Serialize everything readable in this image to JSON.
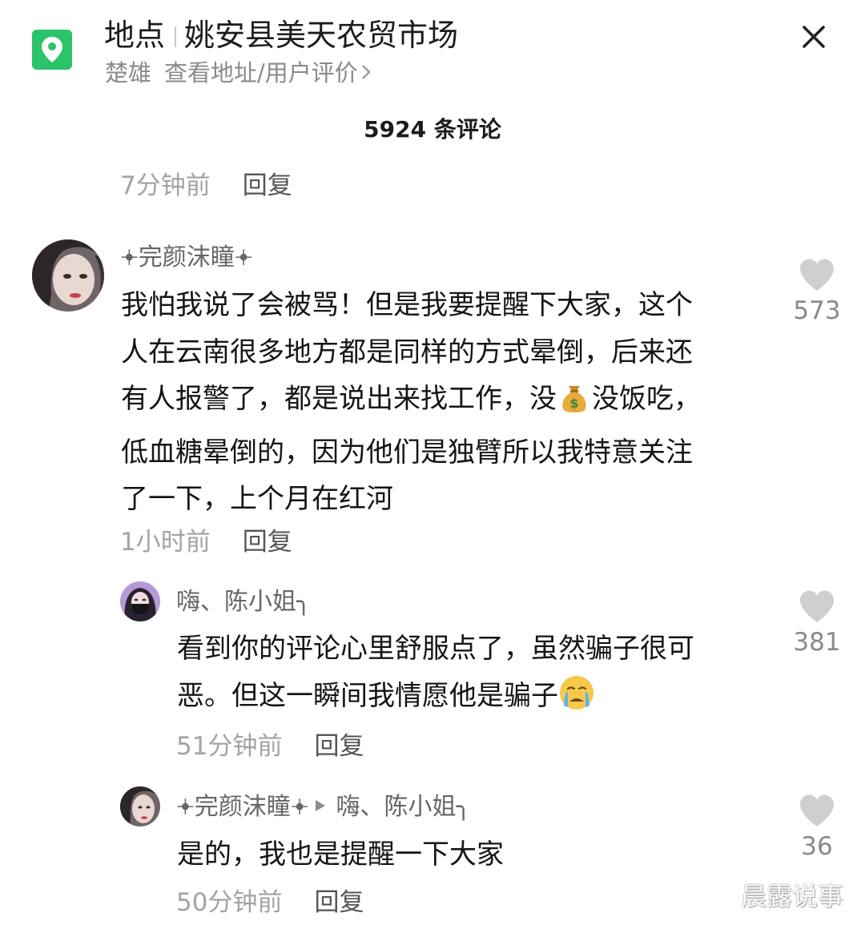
{
  "header": {
    "label": "地点",
    "place_name": "姚安县美天农贸市场",
    "city": "楚雄",
    "address_link": "查看地址/用户评价",
    "brand_color": "#2cc36b"
  },
  "comment_count": "5924 条评论",
  "reply_label": "回复",
  "top_partial": {
    "time": "7分钟前"
  },
  "comments": [
    {
      "username": "𖥔完颜沫瞳𖥔",
      "lines": [
        "我怕我说了会被骂！但是我要提醒下大家，这个",
        "人在云南很多地方都是同样的方式晕倒，后来还",
        "有人报警了，都是说出来找工作，没",
        "没饭吃，",
        "低血糖晕倒的，因为他们是独臂所以我特意关注",
        "了一下，上个月在红河"
      ],
      "emoji": "money-bag-icon",
      "time": "1小时前",
      "likes": "573"
    }
  ],
  "replies": [
    {
      "username": "嗨、陈小姐╮",
      "lines": [
        "看到你的评论心里舒服点了，虽然骗子很可",
        "恶。但这一瞬间我情愿他是骗子"
      ],
      "emoji": "crying-face-icon",
      "time": "51分钟前",
      "likes": "381"
    },
    {
      "username": "𖥔完颜沫瞳𖥔",
      "reply_to": "嗨、陈小姐╮",
      "lines": [
        "是的，我也是提醒一下大家"
      ],
      "time": "50分钟前",
      "likes": "36"
    }
  ],
  "watermark": "晨露说事"
}
